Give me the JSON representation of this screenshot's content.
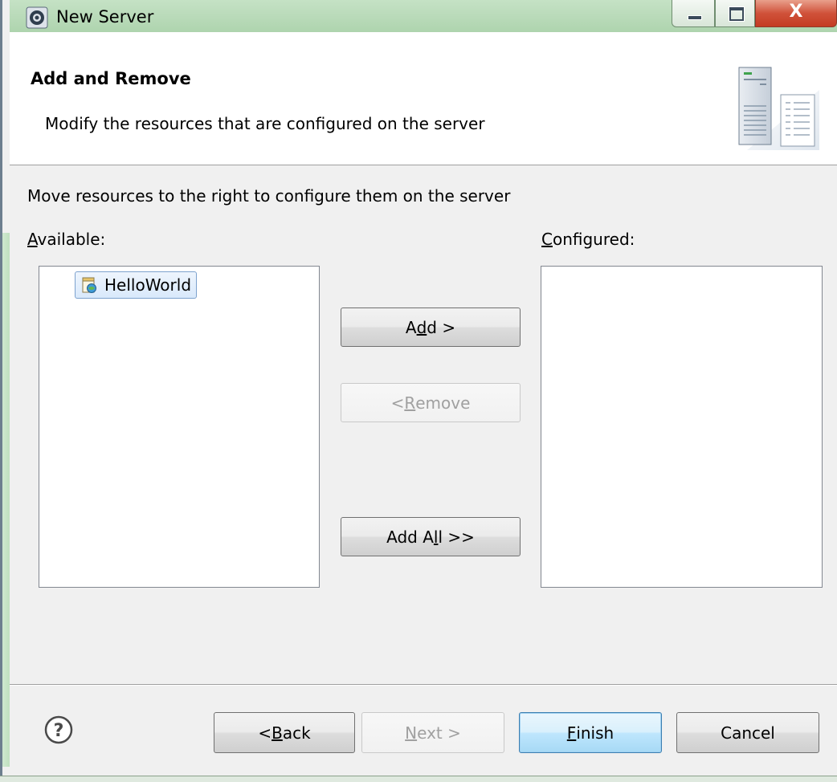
{
  "window": {
    "title": "New Server",
    "controls": {
      "minimize": "minimize",
      "maximize": "maximize",
      "close": "X"
    }
  },
  "header": {
    "title": "Add and Remove",
    "description": "Modify the resources that are configured on the server"
  },
  "body": {
    "instruction": "Move resources to the right to configure them on the server",
    "available": {
      "label_mnemonic": "A",
      "label_rest": "vailable:",
      "items": [
        {
          "label": "HelloWorld",
          "icon": "project-icon",
          "selected": true
        }
      ]
    },
    "configured": {
      "label_mnemonic": "C",
      "label_rest": "onfigured:",
      "items": []
    },
    "buttons": {
      "add": {
        "pre": "A",
        "mnemonic": "d",
        "post": "d >",
        "enabled": true
      },
      "remove": {
        "pre": "< ",
        "mnemonic": "R",
        "post": "emove",
        "enabled": false
      },
      "add_all": {
        "pre": "Add A",
        "mnemonic": "l",
        "post": "l >>",
        "enabled": true
      }
    }
  },
  "footer": {
    "help_icon": "help-icon",
    "back": {
      "pre": "< ",
      "mnemonic": "B",
      "post": "ack",
      "enabled": true
    },
    "next": {
      "pre": "",
      "mnemonic": "N",
      "post": "ext >",
      "enabled": false
    },
    "finish": {
      "pre": "",
      "mnemonic": "F",
      "post": "inish",
      "enabled": true,
      "default": true
    },
    "cancel": {
      "label": "Cancel",
      "enabled": true
    }
  },
  "colors": {
    "titlebar": "#bcdcbc",
    "close_button": "#c43b22",
    "selection": "#d9e9fb",
    "default_button": "#bee6fd"
  }
}
